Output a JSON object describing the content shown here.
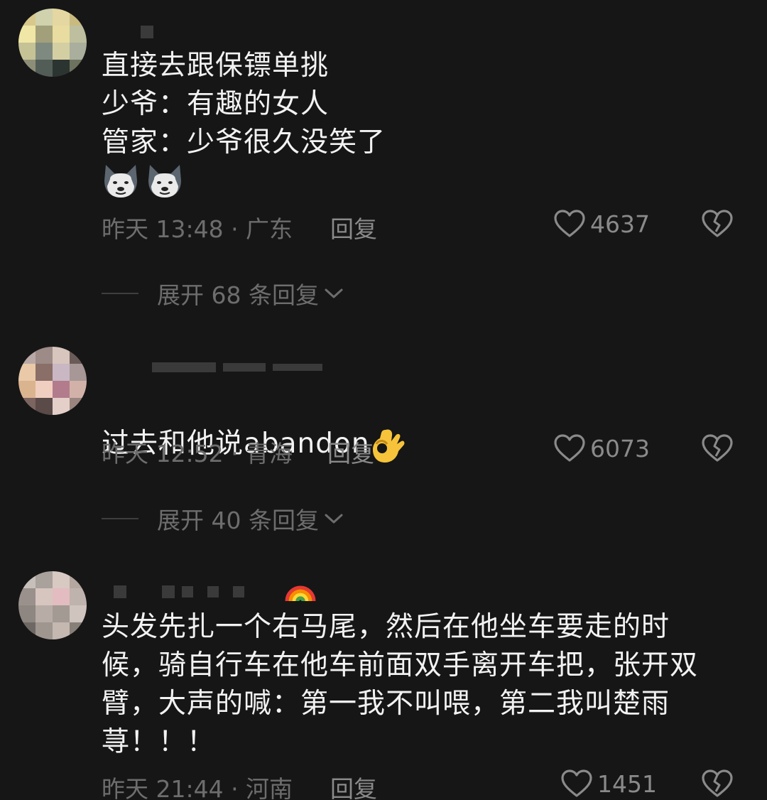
{
  "comments": [
    {
      "lines": "直接去跟保镖单挑\n少爷：有趣的女人\n管家：少爷很久没笑了",
      "time_location": "昨天 13:48 · 广东",
      "reply_label": "回复",
      "likes": "4637",
      "expand_label": "展开 68 条回复",
      "reaction_icon": "husky-dog-emoji"
    },
    {
      "lines": "过去和他说abandon",
      "time_location": "昨天 12:52 · 青海",
      "reply_label": "回复",
      "likes": "6073",
      "expand_label": "展开 40 条回复",
      "reaction_icon": "ok-hand-emoji"
    },
    {
      "lines": "头发先扎一个右马尾，然后在他坐车要走的时候，骑自行车在他车前面双手离开车把，张开双臂，大声的喊：第一我不叫喂，第二我叫楚雨荨！！！",
      "time_location": "昨天 21:44 · 河南",
      "reply_label": "回复",
      "likes": "1451",
      "username_icon": "rainbow-emoji"
    }
  ],
  "colors": {
    "background": "#161616",
    "text": "#f2f2f2",
    "meta_text": "#6d6d6d",
    "action_text": "#8a8a8a"
  }
}
